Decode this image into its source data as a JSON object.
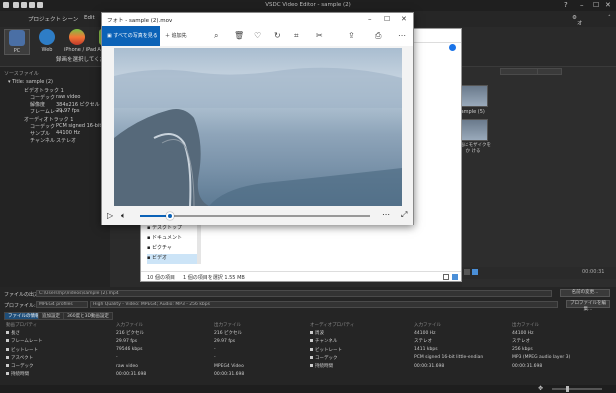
{
  "app": {
    "title": "VSDC Video Editor - sample (2)",
    "options_label": "オプション"
  },
  "menu": {
    "items": [
      "プロジェクト",
      "シーン",
      "Edit"
    ]
  },
  "ribbon": {
    "buttons": [
      {
        "label": "PC"
      },
      {
        "label": "Web"
      },
      {
        "label": "iPhone / iPad"
      },
      {
        "label": "Android"
      }
    ],
    "hint": "録画を選択してください"
  },
  "left_panel": {
    "header": "ソースファイル",
    "tree": {
      "root": "Title: sample (2)",
      "video_track_label": "ビデオトラック 1",
      "video_codec_label": "コーデック",
      "video_codec_value": "raw video",
      "resolution_label": "解像度",
      "resolution_value": "384x216 ピクセル",
      "framerate_label": "フレームレート",
      "framerate_value": "29.97 fps",
      "audio_track_label": "オーディオトラック 1",
      "audio_codec_label": "コーデック",
      "audio_codec_value": "PCM signed 16-bit",
      "samplerate_label": "サンプル",
      "samplerate_value": "44100 Hz",
      "channels_label": "チャンネル",
      "channels_value": "ステレオ"
    }
  },
  "right_area": {
    "thumb1_label": "sample (5)",
    "thumb2_label": "動画にモザイクをか ける"
  },
  "settings": {
    "output_file_label": "ファイルの出力:",
    "output_file_value": "C:\\Users\\hp\\Videos\\sample (2).mp4",
    "change_name_button": "名前の変更...",
    "profile_label": "プロファイル:",
    "profile_format": "MPEG4 profiles",
    "profile_value": "High Quality - Video: MPEG4; Audio: MP3 - 256 kbps",
    "edit_profile_button": "プロファイルを編集...",
    "tabs": [
      "ファイルの情報",
      "追加設定",
      "360度と3D動画設定"
    ],
    "video_table": {
      "headers": [
        "動画プロパティ",
        "入力ファイル",
        "出力ファイル"
      ],
      "rows": [
        [
          "長さ",
          "216 ピクセル",
          "216 ピクセル"
        ],
        [
          "フレームレート",
          "29.97 fps",
          "29.97 fps"
        ],
        [
          "ビットレート",
          "79546 kbps",
          "-"
        ],
        [
          "アスペクト",
          "-",
          "-"
        ],
        [
          "コーデック",
          "raw video",
          "MPEG4 Video"
        ],
        [
          "持続時間",
          "00:00:31.698",
          "00:00:31.698"
        ]
      ]
    },
    "audio_table": {
      "headers": [
        "オーディオプロパティ",
        "入力ファイル",
        "出力ファイル"
      ],
      "rows": [
        [
          "周波",
          "44100 Hz",
          "44100 Hz"
        ],
        [
          "チャンネル",
          "ステレオ",
          "ステレオ"
        ],
        [
          "ビットレート",
          "1411 kbps",
          "256 kbps"
        ],
        [
          "コーデック",
          "PCM signed 16-bit little-endian",
          "MP3 (MPEG audio layer 3)"
        ],
        [
          "持続時間",
          "00:00:31.698",
          "00:00:31.698"
        ]
      ]
    }
  },
  "photos_app": {
    "title": "フォト - sample (2).mov",
    "all_items": "すべての写真を見る",
    "add_to": "追加先",
    "progress_fraction": 0.13
  },
  "explorer": {
    "nav_items": [
      "デスクトップ",
      "ドキュメント",
      "ピクチャ",
      "ビデオ"
    ],
    "status_left": "10 個の項目",
    "status_mid": "1 個の項目を選択  1.55 MB"
  },
  "timeline": {
    "time": "00:00:31"
  },
  "colors": {
    "accent": "#0b62b7",
    "vsdc_dark": "#2b2b2b",
    "tab_active": "#1f4e79"
  }
}
